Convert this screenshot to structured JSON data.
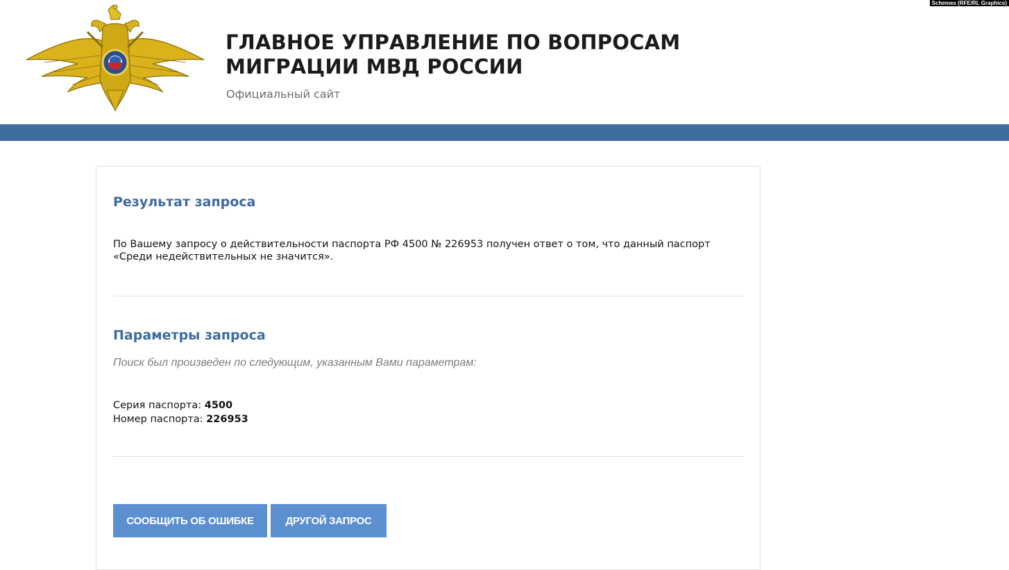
{
  "watermark": "Schemes (RFE/RL Graphics)",
  "header": {
    "title_line1": "ГЛАВНОЕ УПРАВЛЕНИЕ ПО ВОПРОСАМ",
    "title_line2": "МИГРАЦИИ МВД РОССИИ",
    "subtitle": "Официальный сайт"
  },
  "result": {
    "title": "Результат запроса",
    "text": "По Вашему запросу о действительности паспорта РФ 4500 № 226953 получен ответ о том, что данный паспорт «Среди недействительных не значится»."
  },
  "params": {
    "title": "Параметры запроса",
    "hint": "Поиск был произведен по следующим, указанным Вами параметрам:",
    "series_label": "Серия паспорта:",
    "series_value": "4500",
    "number_label": "Номер паспорта:",
    "number_value": "226953"
  },
  "buttons": {
    "report_error": "СООБЩИТЬ ОБ ОШИБКЕ",
    "new_request": "ДРУГОЙ ЗАПРОС"
  },
  "colors": {
    "band": "#3f6d9e",
    "heading": "#3d6aa0",
    "button": "#5b8fd0",
    "emblem_gold": "#d4af1f"
  },
  "icons": {
    "emblem": "double-headed-eagle-emblem-icon"
  }
}
